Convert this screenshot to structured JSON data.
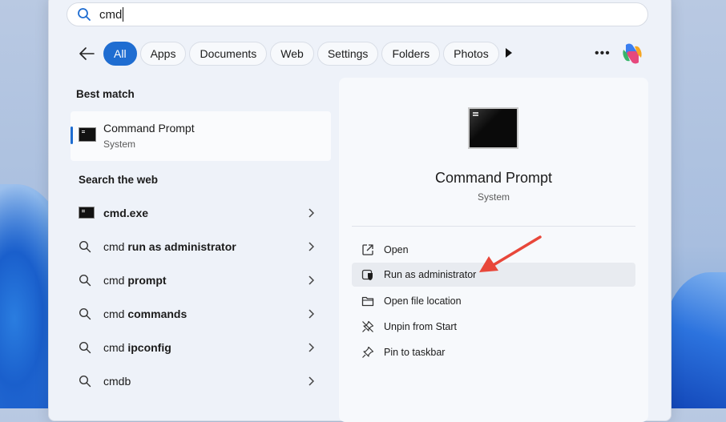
{
  "search": {
    "query": "cmd"
  },
  "filters": [
    "All",
    "Apps",
    "Documents",
    "Web",
    "Settings",
    "Folders",
    "Photos"
  ],
  "left": {
    "best_match_title": "Best match",
    "best": {
      "title": "Command Prompt",
      "subtitle": "System"
    },
    "web_title": "Search the web",
    "web_items": [
      {
        "prefix": "",
        "bold": "cmd.exe",
        "icon": "cmd-icon"
      },
      {
        "prefix": "cmd ",
        "bold": "run as administrator",
        "icon": "search-icon"
      },
      {
        "prefix": "cmd ",
        "bold": "prompt",
        "icon": "search-icon"
      },
      {
        "prefix": "cmd ",
        "bold": "commands",
        "icon": "search-icon"
      },
      {
        "prefix": "cmd ",
        "bold": "ipconfig",
        "icon": "search-icon"
      },
      {
        "prefix": "cmdb",
        "bold": "",
        "icon": "search-icon"
      }
    ]
  },
  "detail": {
    "title": "Command Prompt",
    "subtitle": "System",
    "actions": [
      {
        "label": "Open",
        "icon": "open-external-icon"
      },
      {
        "label": "Run as administrator",
        "icon": "shield-icon"
      },
      {
        "label": "Open file location",
        "icon": "folder-icon"
      },
      {
        "label": "Unpin from Start",
        "icon": "unpin-icon"
      },
      {
        "label": "Pin to taskbar",
        "icon": "pin-icon"
      }
    ]
  },
  "colors": {
    "accent": "#1f6dd1",
    "annotation_arrow": "#e8473a"
  }
}
